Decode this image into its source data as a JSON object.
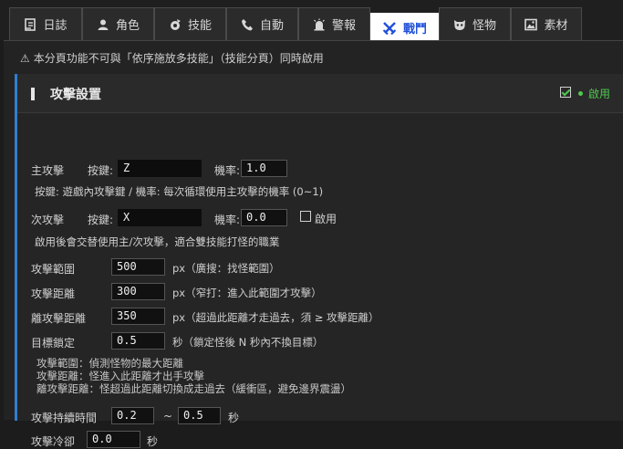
{
  "tabs": [
    {
      "label": "日誌",
      "icon": "log-icon"
    },
    {
      "label": "角色",
      "icon": "user-icon"
    },
    {
      "label": "技能",
      "icon": "skill-icon"
    },
    {
      "label": "自動",
      "icon": "phone-icon"
    },
    {
      "label": "警報",
      "icon": "alarm-icon"
    },
    {
      "label": "戰鬥",
      "icon": "crossed-swords-icon",
      "active": true
    },
    {
      "label": "怪物",
      "icon": "monster-icon"
    },
    {
      "label": "素材",
      "icon": "image-icon"
    }
  ],
  "warning": {
    "icon": "⚠",
    "text": "本分頁功能不可與「依序施放多技能」（技能分頁）同時啟用"
  },
  "section": {
    "title": "攻擊設置",
    "enable_label": "啟用",
    "enabled": true,
    "accent": "#2f7fd0",
    "enable_color": "#4ec94e"
  },
  "primary": {
    "label": "主攻擊",
    "key_label": "按鍵:",
    "key_value": "Z",
    "rate_label": "機率:",
    "rate_value": "1.0"
  },
  "primary_hint": "按鍵: 遊戲內攻擊鍵 / 機率: 每次循環使用主攻擊的機率 (0~1)",
  "secondary": {
    "label": "次攻擊",
    "key_label": "按鍵:",
    "key_value": "X",
    "rate_label": "機率:",
    "rate_value": "0.0",
    "enable_label": "啟用",
    "enabled": false
  },
  "secondary_hint": "啟用後會交替使用主/次攻擊，適合雙技能打怪的職業",
  "fields": [
    {
      "label": "攻擊範圍",
      "value": "500",
      "hint": "px（廣搜：找怪範圍）"
    },
    {
      "label": "攻擊距離",
      "value": "300",
      "hint": "px（窄打：進入此範圍才攻擊）"
    },
    {
      "label": "離攻擊距離",
      "value": "350",
      "hint": "px（超過此距離才走過去，須 ≥ 攻擊距離）"
    },
    {
      "label": "目標鎖定",
      "value": "0.5",
      "hint": "秒（鎖定怪後 N 秒內不換目標）"
    }
  ],
  "notes": [
    "攻擊範圍：偵測怪物的最大距離",
    "攻擊距離：怪進入此距離才出手攻擊",
    "離攻擊距離：怪超過此距離切換成走過去（緩衝區，避免邊界震盪）"
  ],
  "duration": {
    "label": "攻擊持續時間",
    "min": "0.2",
    "sep": "~",
    "max": "0.5",
    "unit": "秒"
  },
  "cooldown": {
    "label": "攻擊冷卻",
    "value": "0.0",
    "unit": "秒"
  }
}
